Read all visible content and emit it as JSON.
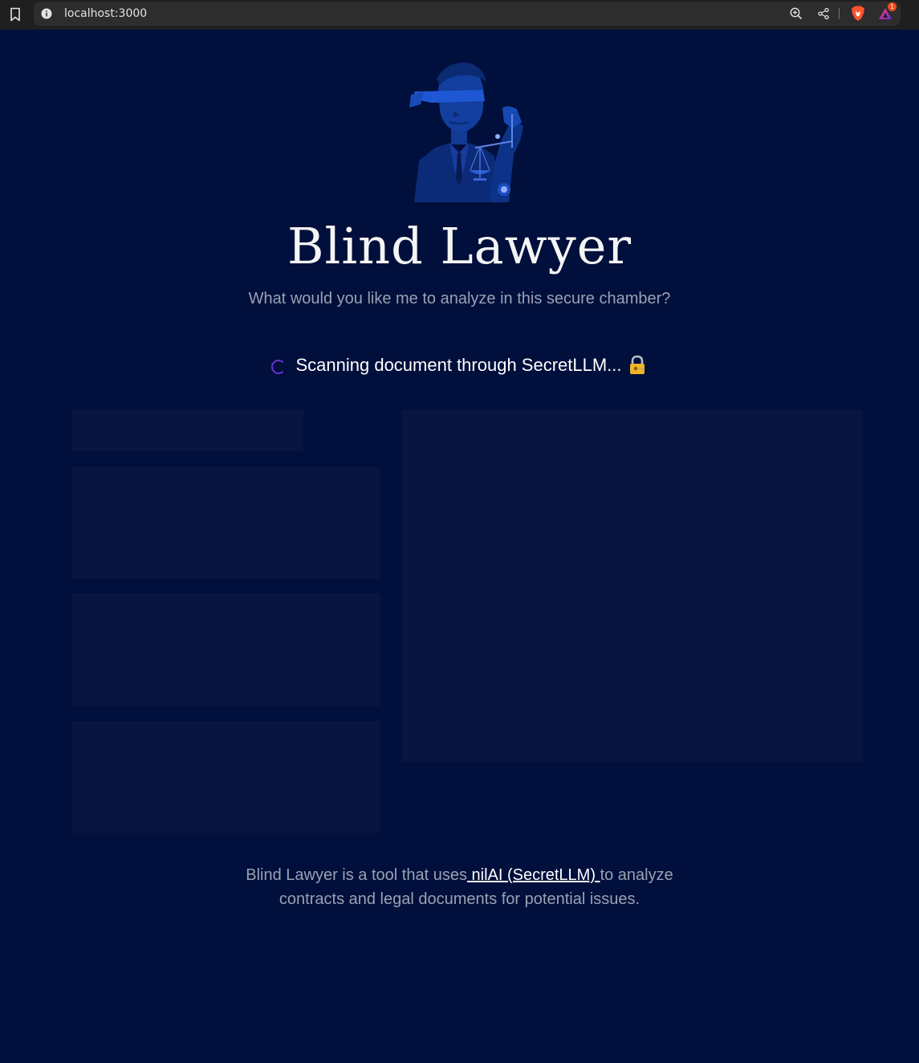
{
  "browser": {
    "url": "localhost:3000",
    "rewards_count": "1"
  },
  "page": {
    "title": "Blind Lawyer",
    "subtitle": "What would you like me to analyze in this secure chamber?",
    "scan_status": "Scanning document through SecretLLM...",
    "scan_emoji": "🔐",
    "footer": {
      "text_before": "Blind Lawyer is a tool that uses",
      "link_text": " nilAI (SecretLLM) ",
      "text_after": "to analyze contracts and legal documents for potential issues."
    }
  },
  "colors": {
    "background": "#000f3b",
    "skeleton": "#08153f",
    "spinner": "#6b2fd1",
    "subtitle": "#9aa1b4"
  },
  "icons": {
    "bookmark": "bookmark-icon",
    "info": "info-icon",
    "zoom": "zoom-icon",
    "share": "share-icon",
    "brave": "brave-lion-icon",
    "rewards": "brave-rewards-icon",
    "lock": "locked-with-key-icon"
  }
}
